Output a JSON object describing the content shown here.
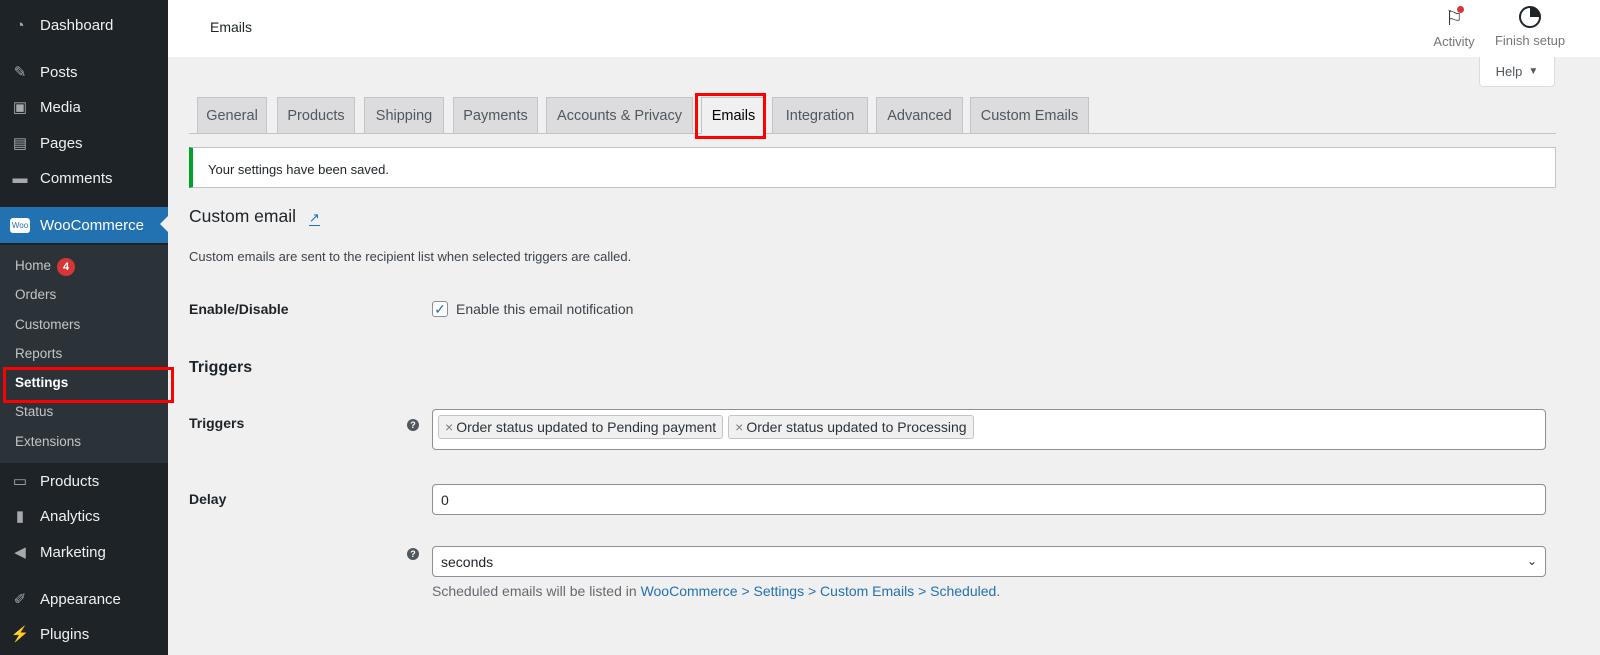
{
  "sidebar": {
    "items": [
      {
        "label": "Dashboard",
        "icon": "dashboard-icon"
      },
      {
        "label": "Posts",
        "icon": "pin-icon"
      },
      {
        "label": "Media",
        "icon": "media-icon"
      },
      {
        "label": "Pages",
        "icon": "pages-icon"
      },
      {
        "label": "Comments",
        "icon": "comment-icon"
      },
      {
        "label": "WooCommerce",
        "icon": "woo-icon"
      },
      {
        "label": "Products",
        "icon": "archive-icon"
      },
      {
        "label": "Analytics",
        "icon": "bar-chart-icon"
      },
      {
        "label": "Marketing",
        "icon": "megaphone-icon"
      },
      {
        "label": "Appearance",
        "icon": "brush-icon"
      },
      {
        "label": "Plugins",
        "icon": "plug-icon"
      }
    ],
    "woo_logo": "Woo",
    "submenu": [
      {
        "label": "Home",
        "badge": "4"
      },
      {
        "label": "Orders"
      },
      {
        "label": "Customers"
      },
      {
        "label": "Reports"
      },
      {
        "label": "Settings"
      },
      {
        "label": "Status"
      },
      {
        "label": "Extensions"
      }
    ]
  },
  "header": {
    "title": "Emails",
    "activity": "Activity",
    "finish_setup": "Finish setup",
    "help": "Help"
  },
  "tabs": [
    "General",
    "Products",
    "Shipping",
    "Payments",
    "Accounts & Privacy",
    "Emails",
    "Integration",
    "Advanced",
    "Custom Emails"
  ],
  "active_tab": "Emails",
  "notice": "Your settings have been saved.",
  "section": {
    "title": "Custom email",
    "description": "Custom emails are sent to the recipient list when selected triggers are called."
  },
  "enable": {
    "label": "Enable/Disable",
    "checkbox_label": "Enable this email notification",
    "checked": true
  },
  "triggers_heading": "Triggers",
  "triggers": {
    "label": "Triggers",
    "values": [
      "Order status updated to Pending payment",
      "Order status updated to Processing"
    ]
  },
  "delay": {
    "label": "Delay",
    "value": "0",
    "unit": "seconds"
  },
  "note": {
    "prefix": "Scheduled emails will be listed in ",
    "link": "WooCommerce > Settings > Custom Emails > Scheduled",
    "suffix": "."
  },
  "colors": {
    "accent": "#2271b1",
    "sidebar": "#1d2327",
    "success": "#00a32a",
    "highlight": "#ff0000"
  }
}
